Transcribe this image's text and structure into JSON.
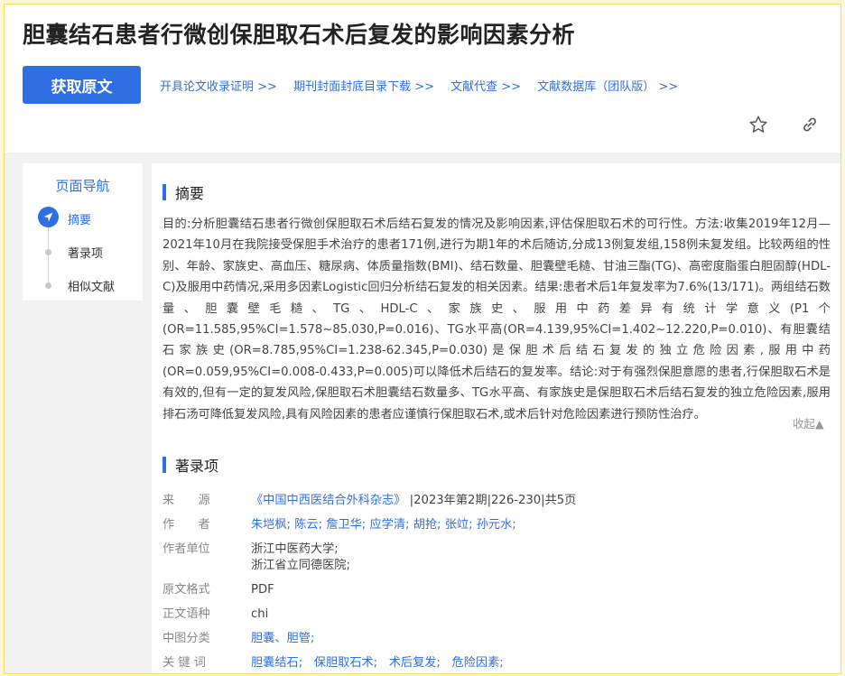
{
  "page": {
    "title": "胆囊结石患者行微创保胆取石术后复发的影响因素分析",
    "get_original_label": "获取原文",
    "links": [
      "开具论文收录证明 >>",
      "期刊封面封底目录下载 >>",
      "文献代查 >>",
      "文献数据库（团队版） >>"
    ]
  },
  "nav": {
    "title": "页面导航",
    "items": [
      "摘要",
      "著录项",
      "相似文献"
    ],
    "active": "摘要"
  },
  "abstract": {
    "heading": "摘要",
    "text": "目的:分析胆囊结石患者行微创保胆取石术后结石复发的情况及影响因素,评估保胆取石术的可行性。方法:收集2019年12月—2021年10月在我院接受保胆手术治疗的患者171例,进行为期1年的术后随访,分成13例复发组,158例未复发组。比较两组的性别、年龄、家族史、高血压、糖尿病、体质量指数(BMI)、结石数量、胆囊壁毛糙、甘油三酯(TG)、高密度脂蛋白胆固醇(HDL-C)及服用中药情况,采用多因素Logistic回归分析结石复发的相关因素。结果:患者术后1年复发率为7.6%(13/171)。两组结石数量、胆囊壁毛糙、TG、HDL-C、家族史、服用中药差异有统计学意义(P1个(OR=11.585,95%CI=1.578~85.030,P=0.016)、TG水平高(OR=4.139,95%CI=1.402~12.220,P=0.010)、有胆囊结石家族史(OR=8.785,95%CI=1.238-62.345,P=0.030)是保胆术后结石复发的独立危险因素,服用中药(OR=0.059,95%CI=0.008-0.433,P=0.005)可以降低术后结石的复发率。结论:对于有强烈保胆意愿的患者,行保胆取石术是有效的,但有一定的复发风险,保胆取石术胆囊结石数量多、TG水平高、有家族史是保胆取石术后结石复发的独立危险因素,服用排石汤可降低复发风险,具有风险因素的患者应谨慎行保胆取石术,或术后针对危险因素进行预防性治疗。",
    "collapse_label": "收起▲"
  },
  "record": {
    "heading": "著录项",
    "source_label": "来　　源",
    "source_journal": "《中国中西医结合外科杂志》",
    "source_detail": "|2023年第2期|226-230|共5页",
    "authors_label": "作　　者",
    "authors": [
      "朱垲枫;",
      "陈云;",
      "詹卫华;",
      "应学清;",
      "胡抢;",
      "张竝;",
      "孙元水;"
    ],
    "affiliation_label": "作者单位",
    "affiliation_1": "浙江中医药大学;",
    "affiliation_2": "浙江省立同德医院;",
    "format_label": "原文格式",
    "format": "PDF",
    "language_label": "正文语种",
    "language": "chi",
    "clc_label": "中图分类",
    "clc": [
      "胆囊、",
      "胆管;"
    ],
    "keywords_label": "关 键 词",
    "keywords": [
      "胆囊结石;",
      "保胆取石术;",
      "术后复发;",
      "危险因素;"
    ]
  },
  "icons": {
    "favorite": "star-icon",
    "link": "link-icon",
    "nav_active": "send-icon"
  },
  "colors": {
    "accent": "#2f6fe4",
    "frame": "#f3dc6a"
  }
}
